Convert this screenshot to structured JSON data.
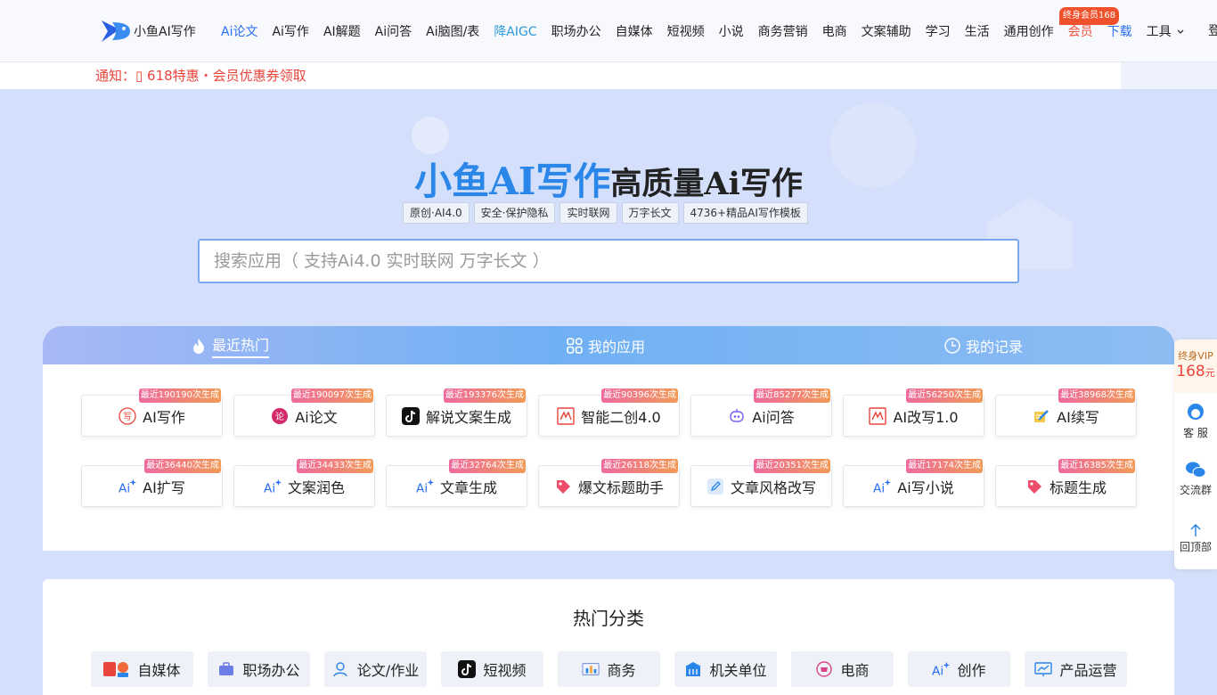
{
  "nav": {
    "logo_text": "小鱼AI写作",
    "items": [
      {
        "label": "Ai论文",
        "style": "active"
      },
      {
        "label": "Ai写作",
        "style": ""
      },
      {
        "label": "AI解题",
        "style": ""
      },
      {
        "label": "Ai问答",
        "style": ""
      },
      {
        "label": "Ai脑图/表",
        "style": ""
      },
      {
        "label": "降AIGC",
        "style": "blue"
      },
      {
        "label": "职场办公",
        "style": ""
      },
      {
        "label": "自媒体",
        "style": ""
      },
      {
        "label": "短视频",
        "style": ""
      },
      {
        "label": "小说",
        "style": ""
      },
      {
        "label": "商务营销",
        "style": ""
      },
      {
        "label": "电商",
        "style": ""
      },
      {
        "label": "文案辅助",
        "style": ""
      },
      {
        "label": "学习",
        "style": ""
      },
      {
        "label": "生活",
        "style": ""
      },
      {
        "label": "通用创作",
        "style": ""
      },
      {
        "label": "会员",
        "style": "red"
      },
      {
        "label": "下载",
        "style": "active"
      },
      {
        "label": "工具",
        "style": "tool"
      }
    ],
    "vip_badge": "终身会员168",
    "edge_text": "登"
  },
  "notice": {
    "text": "通知：▯ 618特惠・会员优惠券领取"
  },
  "hero": {
    "title_brand": "小鱼AI写作",
    "title_rest": "高质量Ai写作",
    "tags": [
      "原创·AI4.0",
      "安全·保护隐私",
      "实时联网",
      "万字长文",
      "4736+精品AI写作模板"
    ]
  },
  "search": {
    "placeholder": "搜索应用（ 支持Ai4.0 实时联网 万字长文 ）",
    "value": ""
  },
  "tabs": {
    "items": [
      {
        "label": "最近热门",
        "icon": "flame-icon"
      },
      {
        "label": "我的应用",
        "icon": "apps-icon"
      },
      {
        "label": "我的记录",
        "icon": "clock-icon"
      }
    ],
    "active": "最近热门"
  },
  "apps": [
    {
      "name": "AI写作",
      "badge": "最近190190次生成",
      "icon": "write-icon"
    },
    {
      "name": "Ai论文",
      "badge": "最近190097次生成",
      "icon": "paper-icon"
    },
    {
      "name": "解说文案生成",
      "badge": "最近193376次生成",
      "icon": "tiktok-icon"
    },
    {
      "name": "智能二创4.0",
      "badge": "最近90396次生成",
      "icon": "rewrite-icon"
    },
    {
      "name": "Ai问答",
      "badge": "最近85277次生成",
      "icon": "robot-icon"
    },
    {
      "name": "AI改写1.0",
      "badge": "最近56250次生成",
      "icon": "rewrite-icon"
    },
    {
      "name": "AI续写",
      "badge": "最近38968次生成",
      "icon": "pencil-icon"
    },
    {
      "name": "AI扩写",
      "badge": "最近36440次生成",
      "icon": "ai-sparkle-icon"
    },
    {
      "name": "文案润色",
      "badge": "最近34433次生成",
      "icon": "ai-sparkle-icon"
    },
    {
      "name": "文章生成",
      "badge": "最近32764次生成",
      "icon": "ai-sparkle-icon"
    },
    {
      "name": "爆文标题助手",
      "badge": "最近26118次生成",
      "icon": "tag-icon"
    },
    {
      "name": "文章风格改写",
      "badge": "最近20351次生成",
      "icon": "edit-icon"
    },
    {
      "name": "Ai写小说",
      "badge": "最近17174次生成",
      "icon": "ai-sparkle-icon"
    },
    {
      "name": "标题生成",
      "badge": "最近16385次生成",
      "icon": "tag-icon"
    }
  ],
  "float_bar": {
    "vip_label": "终身VIP",
    "vip_price": "168",
    "vip_unit": "元",
    "service": "客 服",
    "group": "交流群",
    "top": "回顶部"
  },
  "categories": {
    "title": "热门分类",
    "items": [
      {
        "name": "自媒体",
        "icon": "media-icon"
      },
      {
        "name": "职场办公",
        "icon": "briefcase-icon"
      },
      {
        "name": "论文/作业",
        "icon": "user-icon"
      },
      {
        "name": "短视频",
        "icon": "tiktok-icon"
      },
      {
        "name": "商务",
        "icon": "chart-icon"
      },
      {
        "name": "机关单位",
        "icon": "building-icon"
      },
      {
        "name": "电商",
        "icon": "shop-icon"
      },
      {
        "name": "创作",
        "icon": "ai-sparkle-icon"
      },
      {
        "name": "产品运营",
        "icon": "board-icon"
      }
    ]
  },
  "colors": {
    "accent": "#2a6ff3",
    "brand_title": "#2a86e8",
    "notice": "#e8453c",
    "badge_from": "#ee6a9e",
    "badge_to": "#f19a57",
    "page_bg": "#d4e0fb"
  }
}
